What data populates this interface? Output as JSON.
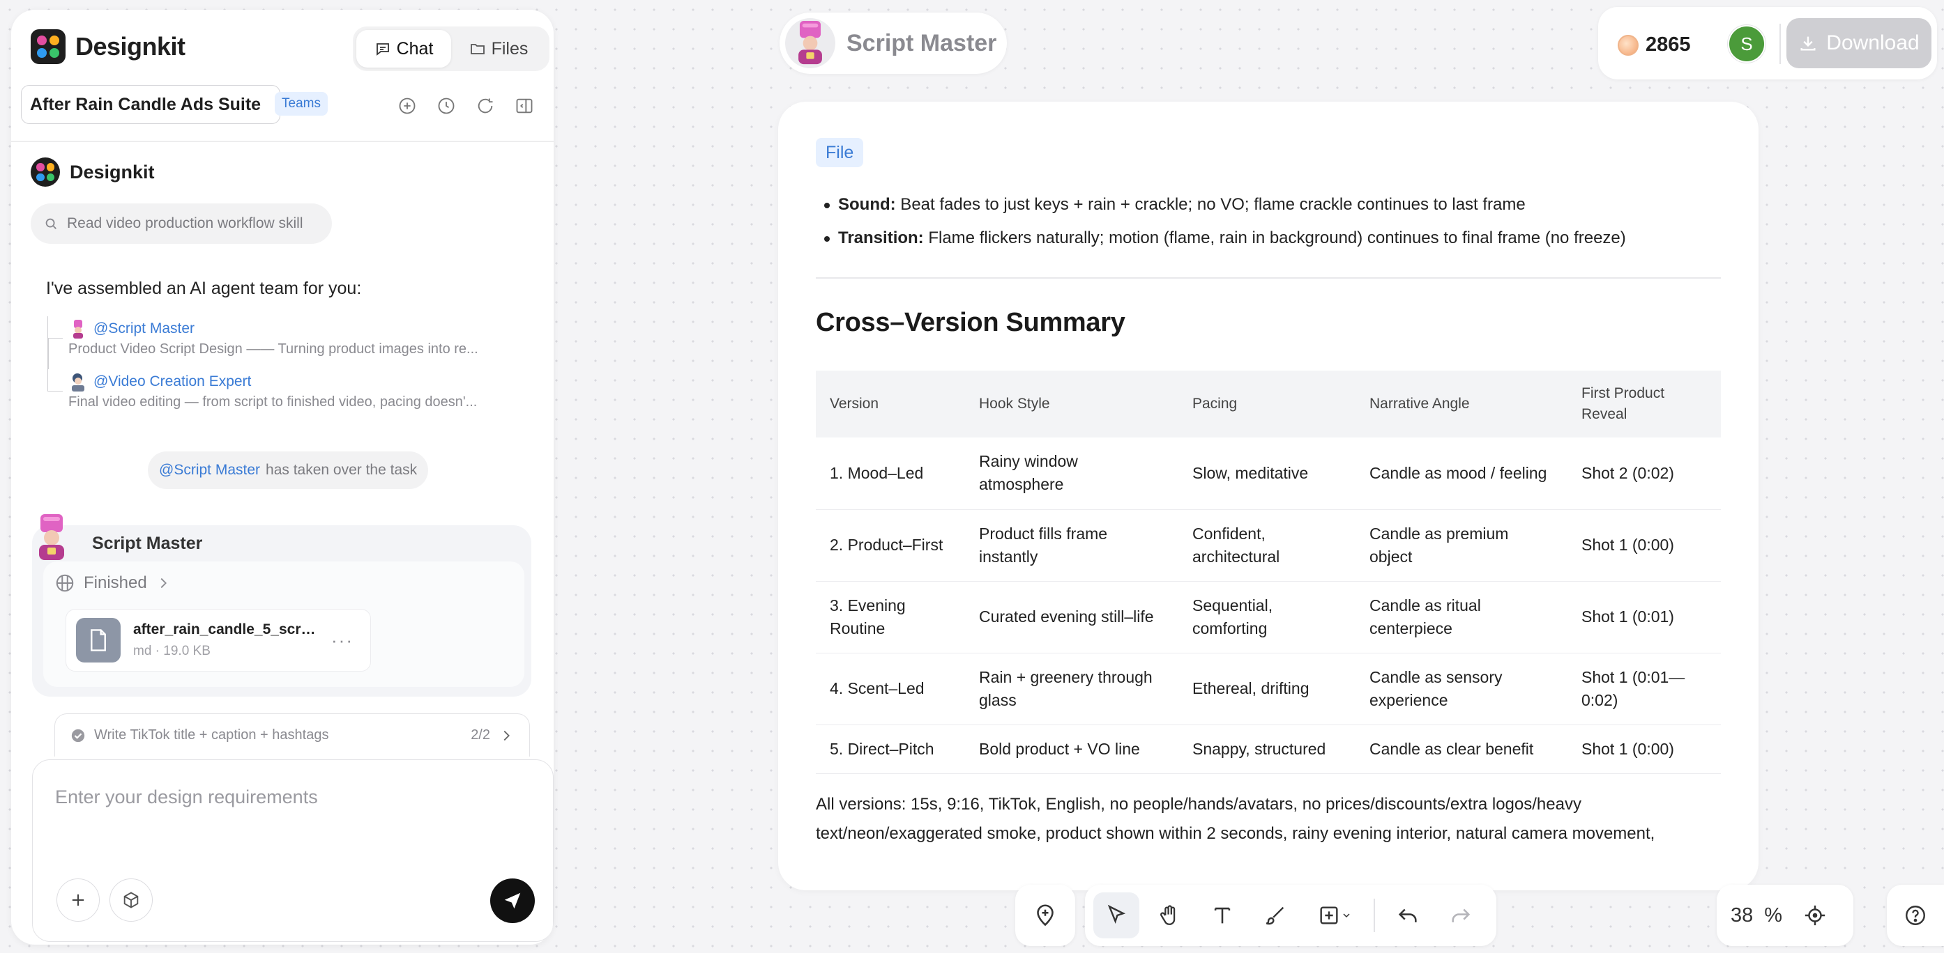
{
  "app": {
    "brand_name": "Designkit",
    "brand_colors": [
      "#e34ea0",
      "#ffb020",
      "#2f9bf0",
      "#39c46a"
    ]
  },
  "sidebar": {
    "tabs": [
      {
        "label": "Chat",
        "icon": "chat-icon",
        "active": true
      },
      {
        "label": "Files",
        "icon": "folder-icon",
        "active": false
      }
    ],
    "project_title": "After Rain Candle Ads Suite",
    "teams_badge": "Teams",
    "header_icons": [
      "add-icon",
      "history-icon",
      "refresh-icon",
      "collapse-panel-icon"
    ]
  },
  "chat": {
    "sender_name": "Designkit",
    "skill_search_text": "Read video production workflow skill",
    "intro_text": "I've assembled an AI agent team for you:",
    "agents": [
      {
        "mention": "@Script Master",
        "description": "Product Video Script Design —— Turning product images into re..."
      },
      {
        "mention": "@Video Creation Expert",
        "description": "Final video editing — from script to finished video, pacing doesn'..."
      }
    ],
    "takeover": {
      "mention": "@Script Master",
      "text": "has taken over the task"
    },
    "task_card": {
      "agent_name": "Script Master",
      "status": "Finished",
      "file": {
        "name": "after_rain_candle_5_scri...",
        "meta": "md · 19.0 KB",
        "more": "···"
      }
    },
    "todo": {
      "text": "Write TikTok title + caption + hashtags",
      "count": "2/2"
    },
    "composer": {
      "placeholder": "Enter your design requirements"
    }
  },
  "canvas_header": {
    "agent_name": "Script Master"
  },
  "account": {
    "credits": "2865",
    "avatar_initial": "S",
    "avatar_color": "#4b9b3a",
    "download_label": "Download"
  },
  "document": {
    "tag": "File",
    "bullets": [
      {
        "label": "Sound:",
        "text": " Beat fades to just keys + rain + crackle; no VO; flame crackle continues to last frame"
      },
      {
        "label": "Transition:",
        "text": " Flame flickers naturally; motion (flame, rain in background) continues to final frame (no freeze)"
      }
    ],
    "summary_title": "Cross–Version Summary",
    "table": {
      "headers": [
        "Version",
        "Hook Style",
        "Pacing",
        "Narrative Angle",
        "First Product Reveal"
      ],
      "rows": [
        [
          "1. Mood–Led",
          "Rainy window atmosphere",
          "Slow, meditative",
          "Candle as mood / feeling",
          "Shot 2 (0:02)"
        ],
        [
          "2. Product–First",
          "Product fills frame instantly",
          "Confident, architectural",
          "Candle as premium object",
          "Shot 1 (0:00)"
        ],
        [
          "3. Evening Routine",
          "Curated evening still–life",
          "Sequential, comforting",
          "Candle as ritual centerpiece",
          "Shot 1 (0:01)"
        ],
        [
          "4. Scent–Led",
          "Rain + greenery through glass",
          "Ethereal, drifting",
          "Candle as sensory experience",
          "Shot 1 (0:01—0:02)"
        ],
        [
          "5. Direct–Pitch",
          "Bold product + VO line",
          "Snappy, structured",
          "Candle as clear benefit",
          "Shot 1 (0:00)"
        ]
      ]
    },
    "footnote": "All versions: 15s, 9:16, TikTok, English, no people/hands/avatars, no prices/discounts/extra logos/heavy text/neon/exaggerated smoke, product shown within 2 seconds, rainy evening interior, natural camera movement,"
  },
  "toolbar": {
    "tools": [
      "add-location-icon",
      "select-cursor-icon",
      "hand-pan-icon",
      "text-tool-icon",
      "brush-icon",
      "insert-box-icon",
      "undo-icon",
      "redo-icon"
    ],
    "active_tool": "select-cursor-icon",
    "zoom_value": "38",
    "zoom_unit": "%"
  }
}
